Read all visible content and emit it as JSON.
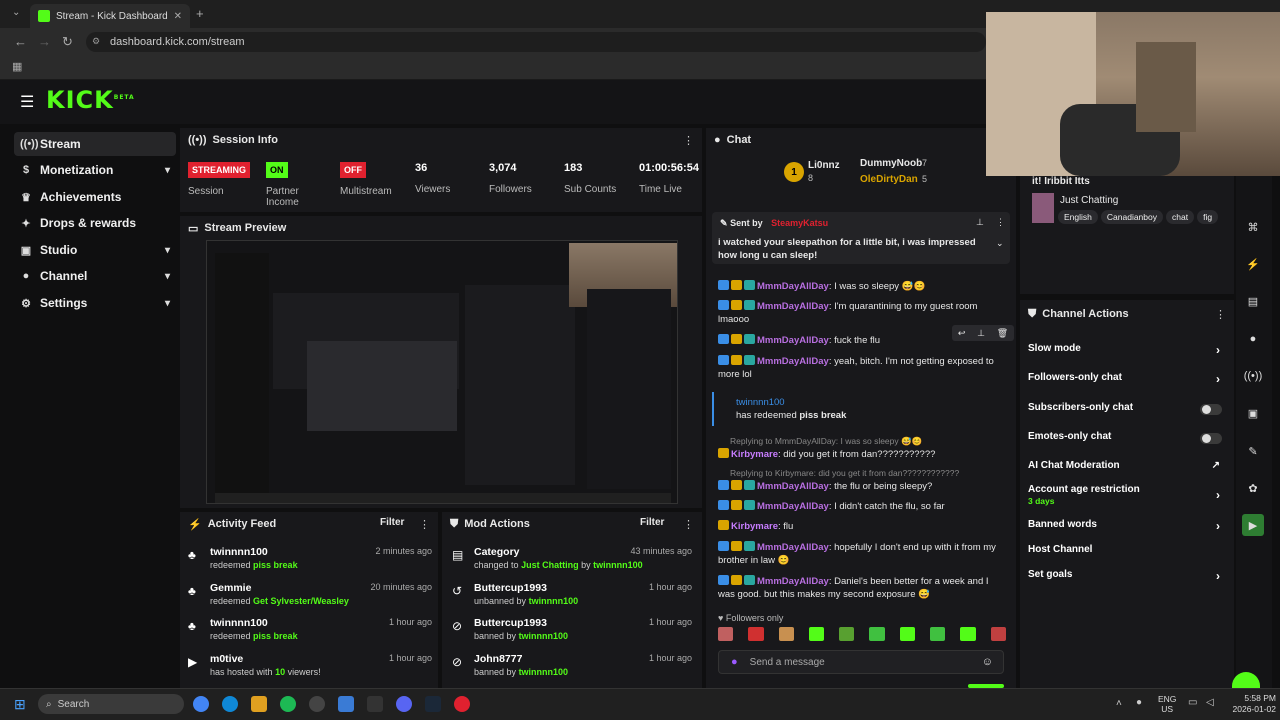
{
  "browser": {
    "tab_title": "Stream - Kick Dashboard",
    "url": "dashboard.kick.com/stream"
  },
  "brand": {
    "logo": "KICK",
    "beta": "BETA",
    "accent": "#53fc18"
  },
  "sidebar": {
    "items": [
      {
        "label": "Stream",
        "icon": "stream-icon"
      },
      {
        "label": "Monetization",
        "icon": "dollar-icon"
      },
      {
        "label": "Achievements",
        "icon": "trophy-icon"
      },
      {
        "label": "Drops & rewards",
        "icon": "gift-icon"
      },
      {
        "label": "Studio",
        "icon": "camera-icon"
      },
      {
        "label": "Channel",
        "icon": "user-icon"
      },
      {
        "label": "Settings",
        "icon": "gear-icon"
      }
    ]
  },
  "session": {
    "title": "Session Info",
    "stats": [
      {
        "value": "STREAMING",
        "label": "Session"
      },
      {
        "value": "ON",
        "label": "Partner Income"
      },
      {
        "value": "OFF",
        "label": "Multistream"
      },
      {
        "value": "36",
        "label": "Viewers"
      },
      {
        "value": "3,074",
        "label": "Followers"
      },
      {
        "value": "183",
        "label": "Sub Counts"
      },
      {
        "value": "01:00:56:54",
        "label": "Time Live"
      }
    ]
  },
  "preview": {
    "title": "Stream Preview"
  },
  "activity": {
    "title": "Activity Feed",
    "filter": "Filter",
    "rows": [
      {
        "name": "twinnnn100",
        "action": "redeemed",
        "detail": "piss break",
        "time": "2 minutes ago"
      },
      {
        "name": "Gemmie",
        "action": "redeemed",
        "detail": "Get Sylvester/Weasley",
        "time": "20 minutes ago"
      },
      {
        "name": "twinnnn100",
        "action": "redeemed",
        "detail": "piss break",
        "time": "1 hour ago"
      },
      {
        "name": "m0tive",
        "action": "has hosted with",
        "detail": "10",
        "suffix": "viewers!",
        "time": "1 hour ago"
      }
    ]
  },
  "mod": {
    "title": "Mod Actions",
    "filter": "Filter",
    "rows": [
      {
        "name": "Category",
        "action": "changed to",
        "detail": "Just Chatting",
        "by": "by",
        "who": "twinnnn100",
        "time": "43 minutes ago"
      },
      {
        "name": "Buttercup1993",
        "action": "unbanned by",
        "who": "twinnnn100",
        "time": "1 hour ago"
      },
      {
        "name": "Buttercup1993",
        "action": "banned by",
        "who": "twinnnn100",
        "time": "1 hour ago"
      },
      {
        "name": "John8777",
        "action": "banned by",
        "who": "twinnnn100",
        "time": "1 hour ago"
      }
    ]
  },
  "chat": {
    "title": "Chat",
    "leaders": [
      {
        "rank": "1",
        "name": "Li0nnz",
        "count": "8"
      },
      {
        "name": "DummyNoob",
        "count": "7"
      },
      {
        "name": "OleDirtyDan",
        "count": "5"
      }
    ],
    "pinned": {
      "sent_by": "Sent by",
      "user": "SteamyKatsu",
      "text": "i watched your sleepathon for a little bit, i was impressed how long u can sleep!"
    },
    "messages": [
      {
        "user": "MmmDayAllDay",
        "text": "I was so sleepy 😅😊"
      },
      {
        "user": "MmmDayAllDay",
        "text": "I'm quarantining to my guest room lmaooo"
      },
      {
        "user": "MmmDayAllDay",
        "text": "fuck the flu"
      },
      {
        "user": "MmmDayAllDay",
        "text": "yeah, bitch. I'm not getting exposed to more lol"
      },
      {
        "user": "Kirbymare",
        "text": "did you get it from dan???????????",
        "reply": "Replying to MmmDayAllDay: I was so sleepy 😅😊"
      },
      {
        "user": "MmmDayAllDay",
        "text": "the flu or being sleepy?",
        "reply": "Replying to Kirbymare: did you get it from dan????????????"
      },
      {
        "user": "MmmDayAllDay",
        "text": "I didn't catch the flu, so far"
      },
      {
        "user": "Kirbymare",
        "text": "flu"
      },
      {
        "user": "MmmDayAllDay",
        "text": "hopefully I don't end up with it from my brother in law 😊"
      },
      {
        "user": "MmmDayAllDay",
        "text": "Daniel's been better for a week and I was good. but this makes my second exposure 😅"
      }
    ],
    "redeem": {
      "user": "twinnnn100",
      "text": "has redeemed",
      "reward": "piss break"
    },
    "mode": "Followers only",
    "input_placeholder": "Send a message"
  },
  "stream_info": {
    "title_partial": "it! Iribbit Itts",
    "category": "Just Chatting",
    "tags": [
      "English",
      "Canadianboy",
      "chat",
      "fig"
    ]
  },
  "channel_actions": {
    "title": "Channel Actions",
    "items": [
      {
        "label": "Slow mode",
        "control": "arrow"
      },
      {
        "label": "Followers-only chat",
        "control": "arrow"
      },
      {
        "label": "Subscribers-only chat",
        "control": "toggle"
      },
      {
        "label": "Emotes-only chat",
        "control": "toggle"
      },
      {
        "label": "AI Chat Moderation",
        "control": "link"
      },
      {
        "label": "Account age restriction",
        "sub": "3 days",
        "control": "arrow"
      },
      {
        "label": "Banned words",
        "control": "arrow"
      },
      {
        "label": "Host Channel",
        "control": "none"
      },
      {
        "label": "Set goals",
        "control": "arrow"
      }
    ]
  },
  "taskbar": {
    "search": "Search",
    "lang": "ENG",
    "region": "US",
    "time": "5:58 PM",
    "date": "2026-01-02"
  }
}
